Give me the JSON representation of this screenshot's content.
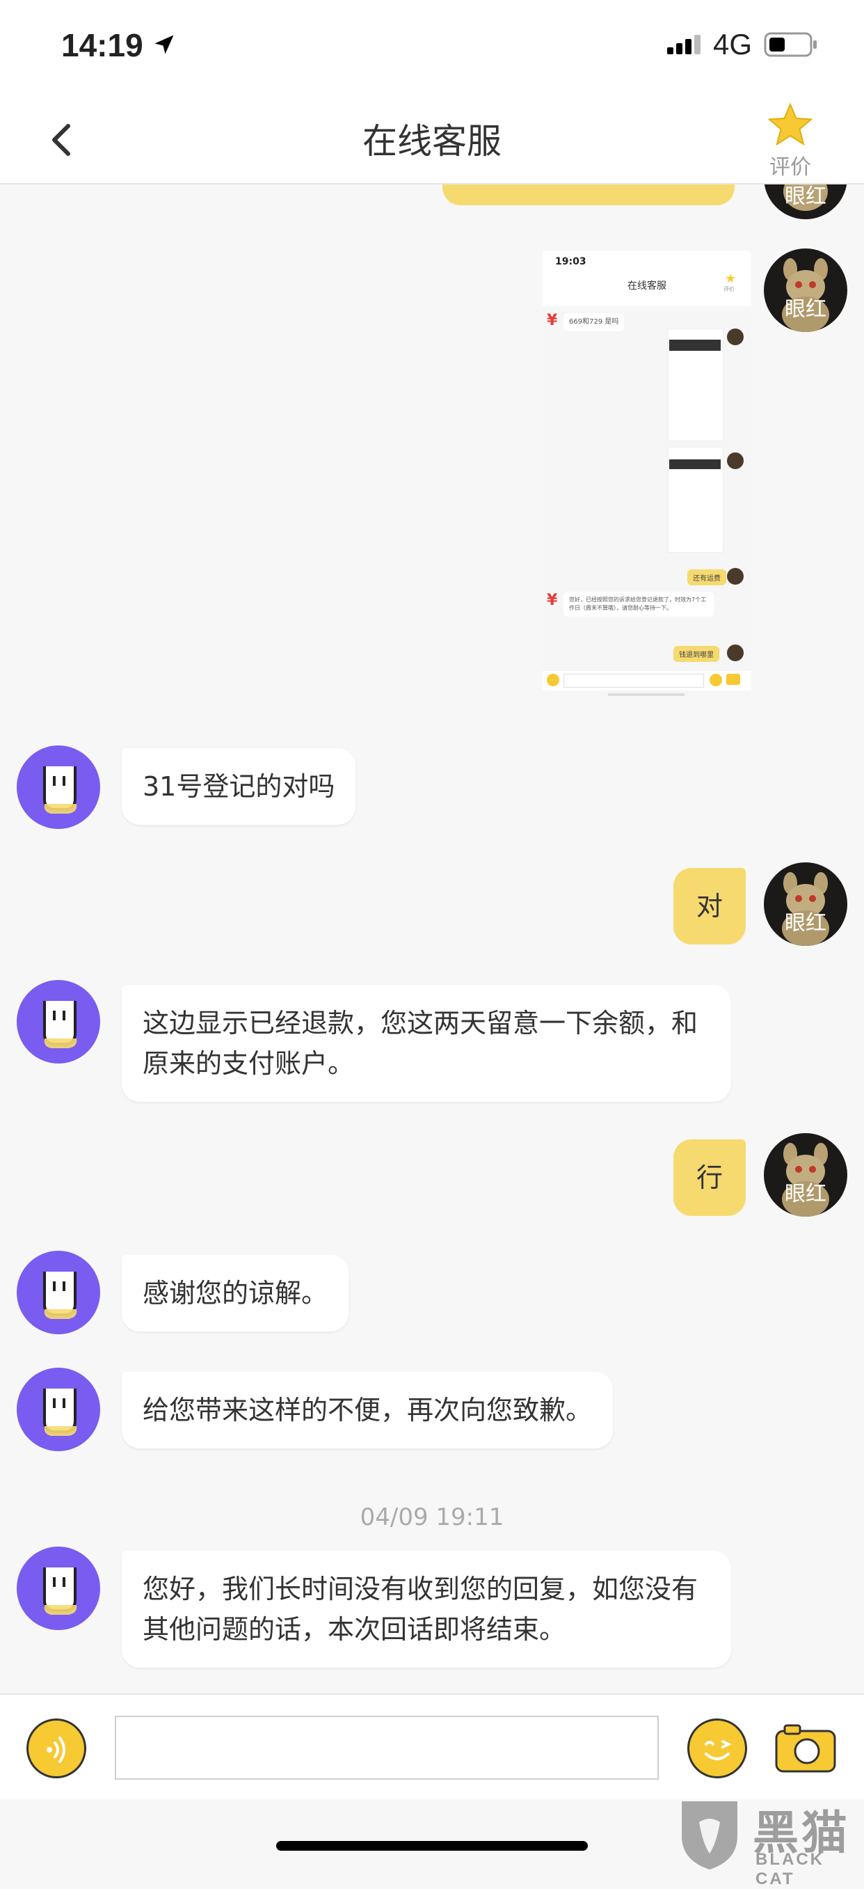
{
  "status_bar": {
    "time": "14:19",
    "network": "4G"
  },
  "nav": {
    "title": "在线客服",
    "rate_label": "评价"
  },
  "user": {
    "nickname": "眼红"
  },
  "embedded_screenshot": {
    "time": "19:03",
    "title": "在线客服",
    "rate_label": "评价",
    "msg1": "669和729 是吗",
    "tag1": "还有运费",
    "reply": "您好，已经按照您的诉求给您登记退款了，时效为7个工作日（周末不算哦），请您耐心等待一下。",
    "tag2": "钱退到哪里"
  },
  "messages": [
    {
      "side": "left",
      "text": "31号登记的对吗"
    },
    {
      "side": "right",
      "text": "对"
    },
    {
      "side": "left",
      "text": "这边显示已经退款，您这两天留意一下余额，和原来的支付账户。"
    },
    {
      "side": "right",
      "text": "行"
    },
    {
      "side": "left",
      "text": "感谢您的谅解。"
    },
    {
      "side": "left",
      "text": "给您带来这样的不便，再次向您致歉。"
    },
    {
      "side": "left",
      "text": "您好，我们长时间没有收到您的回复，如您没有其他问题的话，本次回话即将结束。"
    }
  ],
  "timestamp": "04/09 19:11",
  "input": {
    "placeholder": ""
  },
  "watermark": {
    "text": "黑猫",
    "sub": "BLACK CAT"
  },
  "colors": {
    "accent": "#f7da6f",
    "bot_avatar": "#7a5cf0",
    "background": "#f7f7f7"
  }
}
